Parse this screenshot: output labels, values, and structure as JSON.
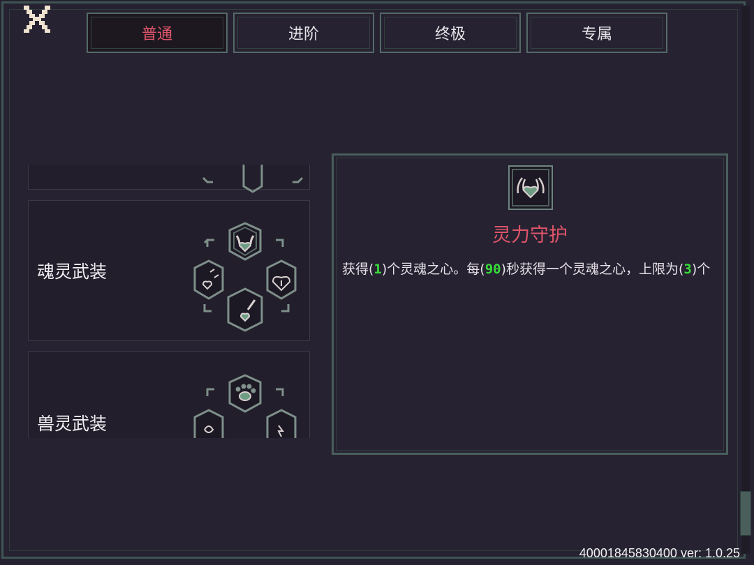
{
  "tabs": [
    {
      "label": "普通",
      "active": true
    },
    {
      "label": "进阶",
      "active": false
    },
    {
      "label": "终极",
      "active": false
    },
    {
      "label": "专属",
      "active": false
    }
  ],
  "cards": [
    {
      "title": ""
    },
    {
      "title": "魂灵武装"
    },
    {
      "title": "兽灵武装"
    }
  ],
  "detail": {
    "icon": "heart-spider-icon",
    "title": "灵力守护",
    "desc": {
      "p1": "获得(",
      "v1": "1",
      "p2": ")个灵魂之心。每(",
      "v2": "90",
      "p3": ")秒获得一个灵魂之心，上限为(",
      "v3": "3",
      "p4": ")个"
    }
  },
  "version": "40001845830400 ver: 1.0.25",
  "colors": {
    "background": "#262231",
    "accent_red": "#e0556a",
    "highlight_green": "#38dd39",
    "frame_teal": "#4a5f5c"
  }
}
